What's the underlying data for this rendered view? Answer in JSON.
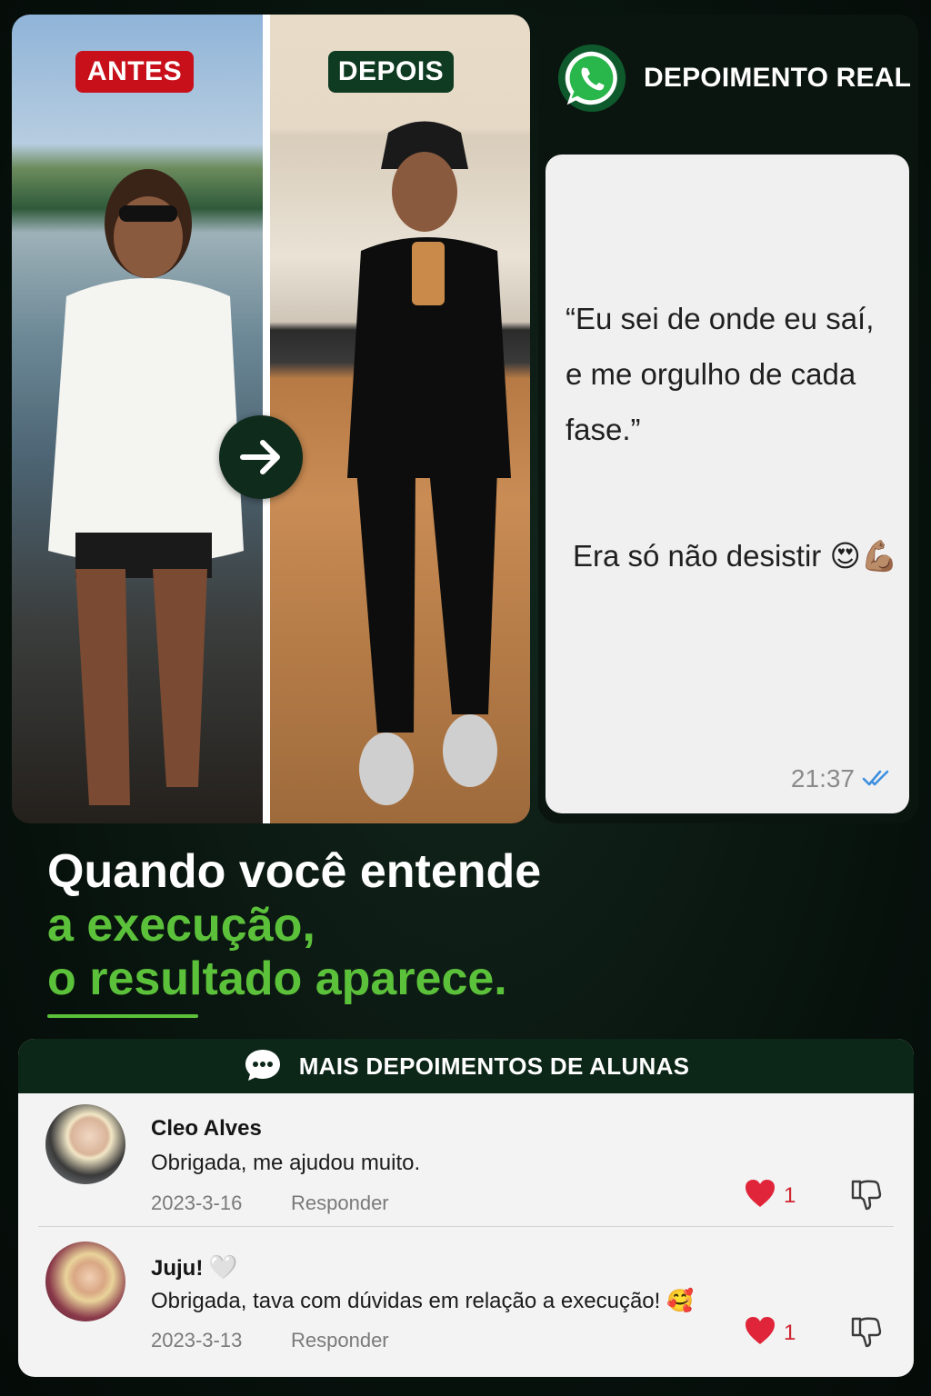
{
  "photo": {
    "before_label": "ANTES",
    "after_label": "DEPOIS"
  },
  "testimonial": {
    "header_title": "DEPOIMENTO REAL",
    "quote": "“Eu sei de onde eu saí,\n e me orgulho de cada\n fase.”",
    "closing": "Era só não desistir 😍💪🏽",
    "time": "21:37",
    "status_icon": "double-check-icon"
  },
  "headline": {
    "line1": "Quando você entende",
    "line2": "a execução,",
    "line3": "o resultado aparece."
  },
  "comments": {
    "title": "MAIS DEPOIMENTOS DE ALUNAS",
    "items": [
      {
        "name": "Cleo Alves",
        "name_suffix": "",
        "text": "Obrigada, me ajudou muito.",
        "date": "2023-3-16",
        "reply_label": "Responder",
        "likes": "1"
      },
      {
        "name": "Juju!",
        "name_suffix": "🤍",
        "text": "Obrigada, tava com dúvidas em relação a execução! 🥰",
        "date": "2023-3-13",
        "reply_label": "Responder",
        "likes": "1"
      }
    ]
  },
  "colors": {
    "accent_green": "#5cc13a",
    "badge_red": "#c8101a",
    "badge_dark_green": "#0f3b22",
    "like_red": "#e0253a",
    "header_green": "#0c2618"
  }
}
